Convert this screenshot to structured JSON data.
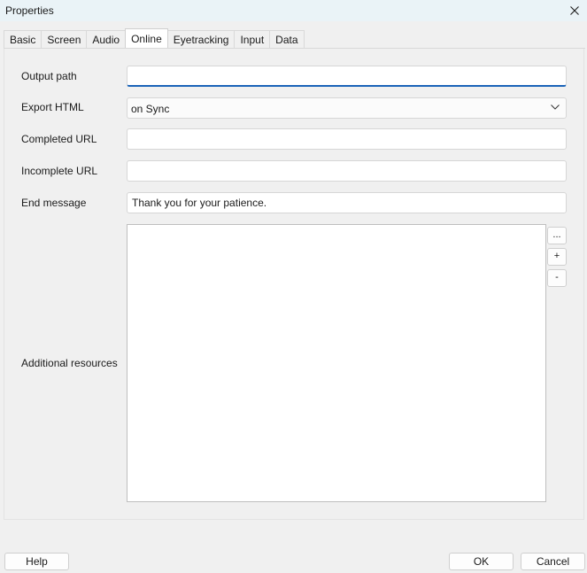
{
  "window": {
    "title": "Properties"
  },
  "tabs": [
    {
      "label": "Basic"
    },
    {
      "label": "Screen"
    },
    {
      "label": "Audio"
    },
    {
      "label": "Online"
    },
    {
      "label": "Eyetracking"
    },
    {
      "label": "Input"
    },
    {
      "label": "Data"
    }
  ],
  "active_tab": "Online",
  "form": {
    "output_path": {
      "label": "Output path",
      "value": ""
    },
    "export_html": {
      "label": "Export HTML",
      "selected": "on Sync"
    },
    "completed_url": {
      "label": "Completed URL",
      "value": ""
    },
    "incomplete_url": {
      "label": "Incomplete URL",
      "value": ""
    },
    "end_message": {
      "label": "End message",
      "value": "Thank you for your patience."
    },
    "additional_resources": {
      "label": "Additional resources",
      "browse_label": "...",
      "add_label": "+",
      "remove_label": "-"
    }
  },
  "buttons": {
    "help": "Help",
    "ok": "OK",
    "cancel": "Cancel"
  },
  "colors": {
    "focus_accent": "#1a63b8",
    "titlebar": "#eaf3f7"
  }
}
